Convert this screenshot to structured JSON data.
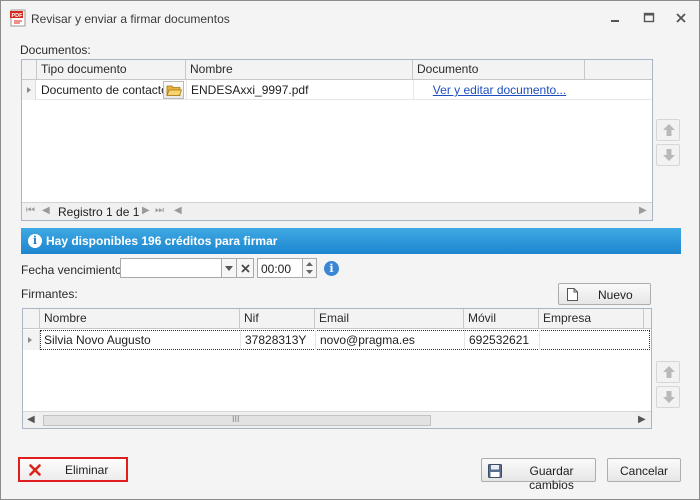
{
  "window": {
    "title": "Revisar y enviar a firmar documentos",
    "app_icon_text": "PDF"
  },
  "documents": {
    "section_label": "Documentos:",
    "columns": [
      "Tipo documento",
      "Nombre",
      "Documento"
    ],
    "rows": [
      {
        "tipo": "Documento de contacto",
        "nombre": "ENDESAxxi_9997.pdf",
        "documento": "Ver y editar  documento..."
      }
    ],
    "navigator": {
      "record_text": "Registro 1 de 1"
    }
  },
  "info_banner": {
    "text": "Hay disponibles 196 créditos para firmar",
    "color": "#1d86cf"
  },
  "expiry": {
    "label": "Fecha vencimiento:",
    "date_value": "",
    "time_value": "00:00"
  },
  "signers": {
    "section_label": "Firmantes:",
    "new_button": "Nuevo",
    "columns": [
      "Nombre",
      "Nif",
      "Email",
      "Móvil",
      "Empresa"
    ],
    "rows": [
      {
        "nombre": "Silvia Novo Augusto",
        "nif": "37828313Y",
        "email": "novo@pragma.es",
        "movil": "692532621",
        "empresa": ""
      }
    ],
    "scroll_thumb_glyph": "III"
  },
  "footer": {
    "delete_button": "Eliminar",
    "save_button": "Guardar cambios",
    "cancel_button": "Cancelar",
    "delete_highlight_color": "#e01e1e"
  },
  "icons": {
    "app": "pdf-document-icon",
    "minimize": "minimize-icon",
    "restore": "restore-icon",
    "close": "close-icon",
    "folder": "folder-open-icon",
    "up": "arrow-up-icon",
    "down": "arrow-down-icon",
    "info": "info-icon",
    "clear": "clear-x-icon",
    "new_doc": "new-document-icon",
    "delete": "delete-x-icon",
    "save": "floppy-disk-icon"
  }
}
